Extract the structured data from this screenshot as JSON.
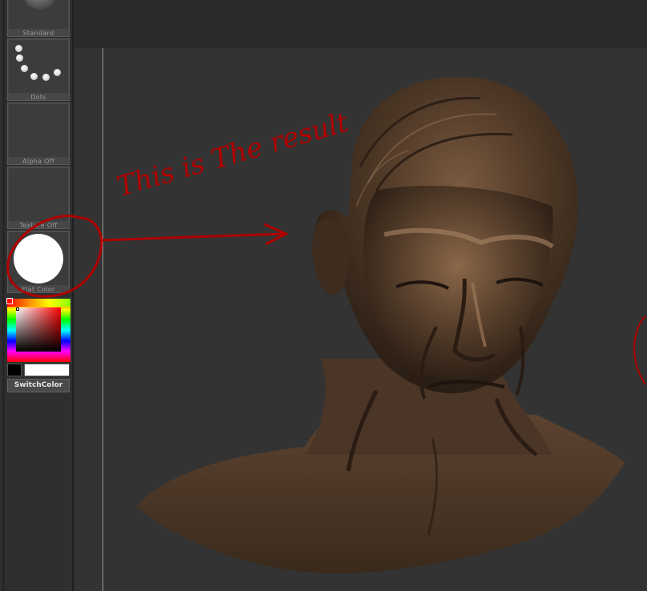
{
  "shelf": {
    "slots": [
      {
        "label": "Standard"
      },
      {
        "label": "Dots"
      },
      {
        "label": "Alpha Off"
      },
      {
        "label": "Texture Off"
      },
      {
        "label": "Flat Color"
      }
    ],
    "switch_color_label": "SwitchColor"
  },
  "annotation": {
    "text": "This is The result",
    "color": "#b00000"
  },
  "colors": {
    "sculpt_base": "#4a3424",
    "canvas_bg": "#333333",
    "primary_color": "#000000",
    "secondary_color": "#ffffff"
  }
}
